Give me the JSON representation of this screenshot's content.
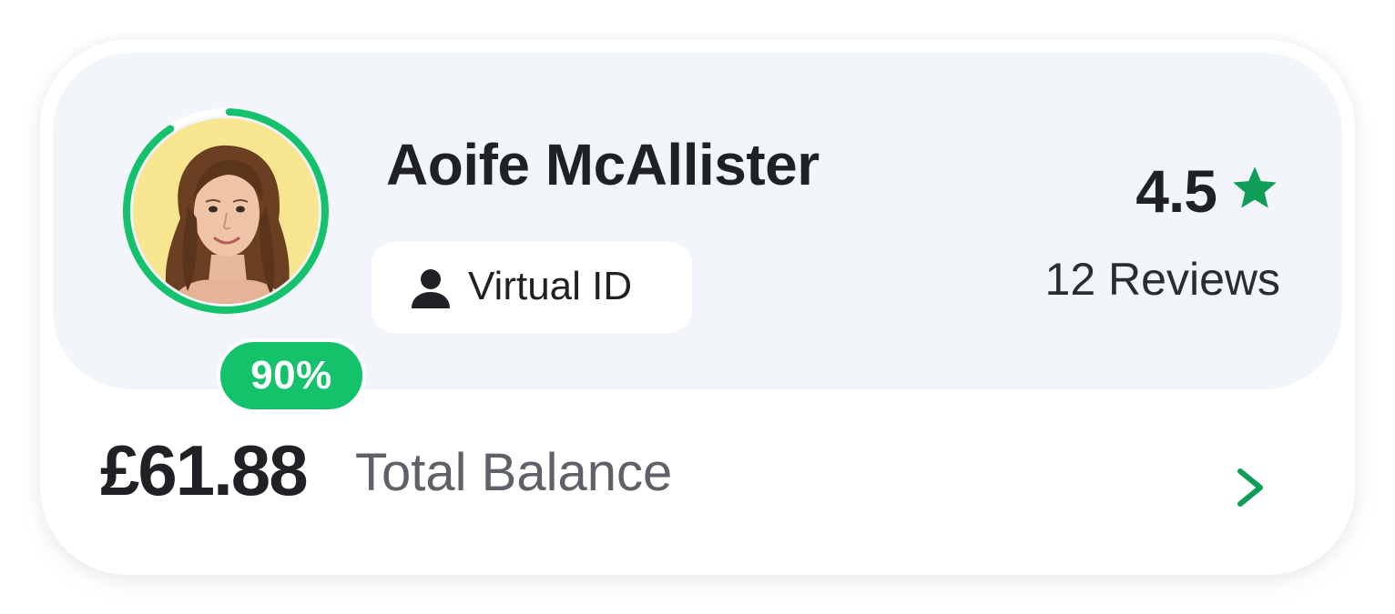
{
  "profile": {
    "name": "Aoife McAllister",
    "completion_percent": 90,
    "completion_label": "90%",
    "virtual_id_label": "Virtual ID",
    "rating": "4.5",
    "reviews": "12 Reviews"
  },
  "balance": {
    "amount": "£61.88",
    "label": "Total Balance"
  },
  "icons": {
    "person": "person-icon",
    "star": "star-icon",
    "chevron": "chevron-right-icon"
  },
  "colors": {
    "accent": "#14c26b",
    "star": "#0f9d58",
    "panel_bg": "#f2f5fa",
    "avatar_bg": "#f7e58f",
    "text_primary": "#1f2125",
    "text_secondary": "#5f6068"
  }
}
